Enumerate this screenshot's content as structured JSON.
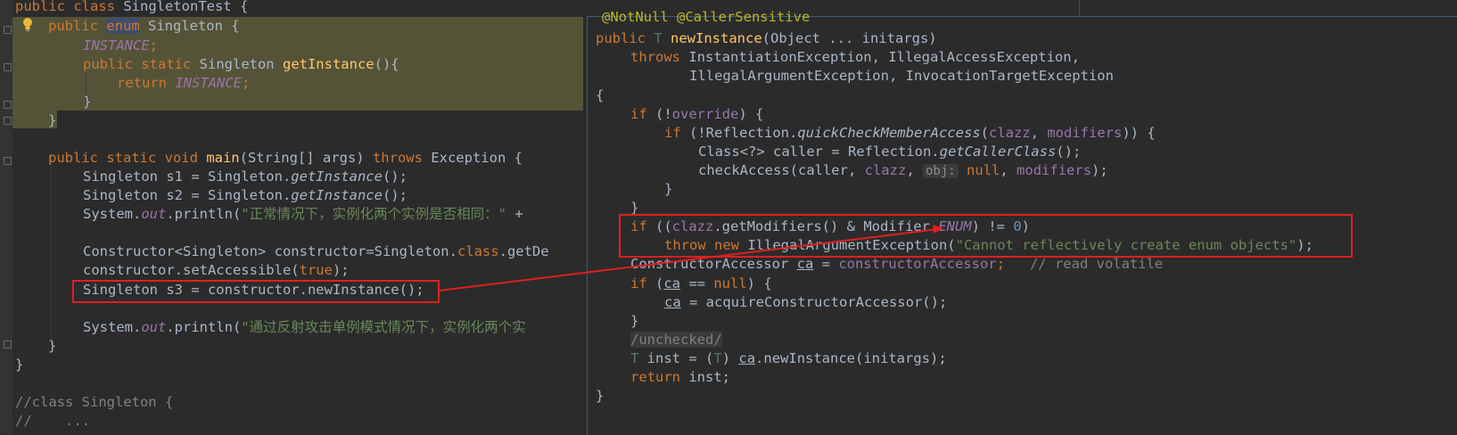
{
  "editor": {
    "lines": {
      "l1": "public class SingletonTest {",
      "l2a": "public ",
      "l2b": "enum",
      "l2c": " Singleton {",
      "l3": "INSTANCE",
      "l4a": "public static ",
      "l4b": "Singleton ",
      "l4c": "getInstance",
      "l4d": "(){",
      "l5a": "return ",
      "l5b": "INSTANCE",
      "l6": "}",
      "l7": "}",
      "l9a": "public static void ",
      "l9b": "main",
      "l9c": "(String[] args) ",
      "l9d": "throws",
      "l9e": " Exception {",
      "l10a": "Singleton s1 = Singleton.",
      "l10b": "getInstance",
      "l10c": "();",
      "l11a": "Singleton s2 = Singleton.",
      "l11b": "getInstance",
      "l11c": "();",
      "l12a": "System.",
      "l12b": "out",
      "l12c": ".println(",
      "l12d": "\"正常情况下，实例化两个实例是否相同：\"",
      "l12e": " +",
      "l14a": "Constructor<Singleton> constructor=Singleton.",
      "l14b": "class",
      "l14c": ".getDe",
      "l15a": "constructor.setAccessible(",
      "l15b": "true",
      "l15c": ");",
      "l16": "Singleton s3 = constructor.newInstance();",
      "l18a": "System.",
      "l18b": "out",
      "l18c": ".println(",
      "l18d": "\"通过反射攻击单例模式情况下，实例化两个实",
      "l19": "}",
      "l20": "}",
      "l22": "//class Singleton {",
      "l23": "//    ..."
    }
  },
  "popup": {
    "top_annotation": "@NotNull @CallerSensitive",
    "lines": {
      "p1a": "public ",
      "p1b": "T",
      "p1c": " ",
      "p1d": "newInstance",
      "p1e": "(Object ... initargs)",
      "p2a": "throws",
      "p2b": " InstantiationException, IllegalAccessException,",
      "p3": "IllegalArgumentException, InvocationTargetException",
      "p4": "{",
      "p5a": "if",
      "p5b": " (!",
      "p5c": "override",
      "p5d": ") {",
      "p6a": "if",
      "p6b": " (!Reflection.",
      "p6c": "quickCheckMemberAccess",
      "p6d": "(",
      "p6e": "clazz",
      "p6f": ", ",
      "p6g": "modifiers",
      "p6h": ")) {",
      "p7a": "Class<?> caller = Reflection.",
      "p7b": "getCallerClass",
      "p7c": "();",
      "p8a": "checkAccess(caller, ",
      "p8b": "clazz",
      "p8c": ", ",
      "p8d": "obj:",
      "p8e": " ",
      "p8f": "null",
      "p8g": ", ",
      "p8h": "modifiers",
      "p8i": ");",
      "p9": "}",
      "p10": "}",
      "p11a": "if",
      "p11b": " ((",
      "p11c": "clazz",
      "p11d": ".getModifiers() & Modifier.",
      "p11e": "ENUM",
      "p11f": ") != ",
      "p11g": "0",
      "p11h": ")",
      "p12a": "throw new",
      "p12b": " IllegalArgumentException(",
      "p12c": "\"Cannot reflectively create enum objects\"",
      "p12d": ");",
      "p13a": "ConstructorAccessor ",
      "p13b": "ca",
      "p13c": " = ",
      "p13d": "constructorAccessor",
      "p13e": ";   ",
      "p13f": "// read volatile",
      "p14a": "if",
      "p14b": " (",
      "p14c": "ca",
      "p14d": " == ",
      "p14e": "null",
      "p14f": ") {",
      "p15a": "ca",
      "p15b": " = acquireConstructorAccessor();",
      "p16": "}",
      "p17": "/unchecked/",
      "p18a": "T",
      "p18b": " inst = (",
      "p18c": "T",
      "p18d": ") ",
      "p18e": "ca",
      "p18f": ".newInstance(initargs);",
      "p19a": "return",
      "p19b": " inst;",
      "p20": "}"
    }
  },
  "colors": {
    "background": "#2b2b2b",
    "keyword": "#cc7832",
    "function": "#ffc66d",
    "string": "#6a8759",
    "number": "#6897bb",
    "field": "#9876aa",
    "highlight": "#5d5a3a",
    "annotation_box": "#e02020"
  },
  "icons": [
    "lightbulb-icon",
    "fold-marker-icon"
  ]
}
